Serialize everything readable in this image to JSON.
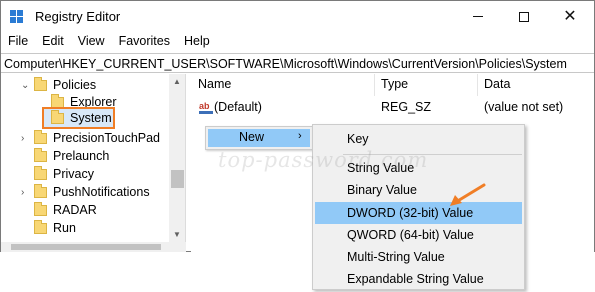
{
  "window": {
    "title": "Registry Editor"
  },
  "menu": [
    "File",
    "Edit",
    "View",
    "Favorites",
    "Help"
  ],
  "address": "Computer\\HKEY_CURRENT_USER\\SOFTWARE\\Microsoft\\Windows\\CurrentVersion\\Policies\\System",
  "tree": {
    "items": [
      {
        "label": "Policies",
        "expanded": true
      },
      {
        "label": "Explorer"
      },
      {
        "label": "System",
        "selected": true
      },
      {
        "label": "PrecisionTouchPad",
        "expandable": true
      },
      {
        "label": "Prelaunch"
      },
      {
        "label": "Privacy"
      },
      {
        "label": "PushNotifications",
        "expandable": true
      },
      {
        "label": "RADAR"
      },
      {
        "label": "Run"
      }
    ]
  },
  "list": {
    "columns": [
      "Name",
      "Type",
      "Data"
    ],
    "rows": [
      {
        "name": "(Default)",
        "type": "REG_SZ",
        "data": "(value not set)",
        "icon": "string-value-icon"
      }
    ]
  },
  "context_menu": {
    "new_label": "New",
    "submenu": [
      "Key",
      "String Value",
      "Binary Value",
      "DWORD (32-bit) Value",
      "QWORD (64-bit) Value",
      "Multi-String Value",
      "Expandable String Value"
    ],
    "highlighted": "DWORD (32-bit) Value"
  },
  "watermark": "top-password.com",
  "colors": {
    "highlight": "#91c9f7",
    "annotation": "#f07e26",
    "selection_box": "#f07e26"
  }
}
